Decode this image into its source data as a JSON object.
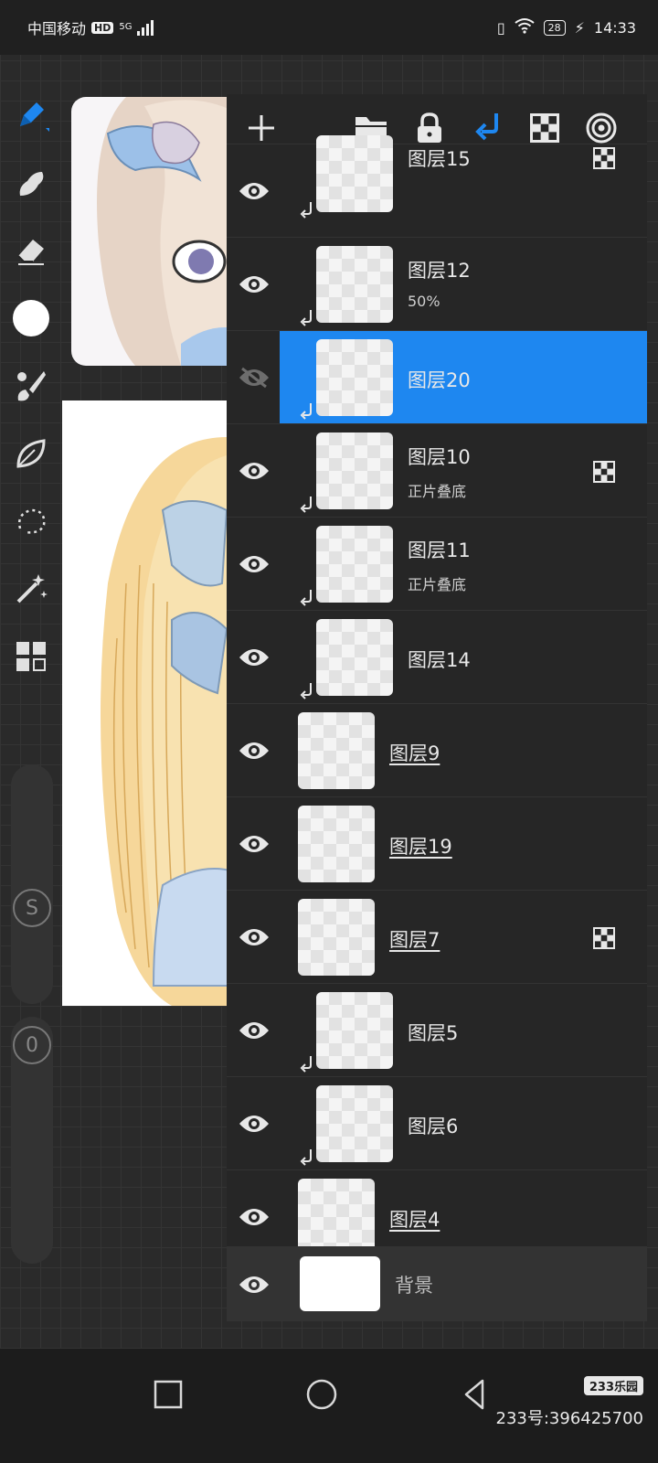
{
  "status_bar": {
    "carrier": "中国移动",
    "hd_badge": "HD",
    "network": "5G",
    "battery": "28",
    "time": "14:33"
  },
  "tool_sliders": {
    "size_label": "S",
    "opacity_label": "0"
  },
  "layers": [
    {
      "name": "图层15",
      "sub": "",
      "clipped": true,
      "alpha_lock": true,
      "selected": false,
      "hidden": false
    },
    {
      "name": "图层12",
      "sub": "50%",
      "clipped": true,
      "alpha_lock": false,
      "selected": false,
      "hidden": false
    },
    {
      "name": "图层20",
      "sub": "",
      "clipped": true,
      "alpha_lock": false,
      "selected": true,
      "hidden": true
    },
    {
      "name": "图层10",
      "sub": "正片叠底",
      "clipped": true,
      "alpha_lock": true,
      "selected": false,
      "hidden": false
    },
    {
      "name": "图层11",
      "sub": "正片叠底",
      "clipped": true,
      "alpha_lock": false,
      "selected": false,
      "hidden": false
    },
    {
      "name": "图层14",
      "sub": "",
      "clipped": true,
      "alpha_lock": false,
      "selected": false,
      "hidden": false
    },
    {
      "name": "图层9",
      "sub": "",
      "clipped": false,
      "alpha_lock": false,
      "selected": false,
      "hidden": false
    },
    {
      "name": "图层19",
      "sub": "",
      "clipped": false,
      "alpha_lock": false,
      "selected": false,
      "hidden": false
    },
    {
      "name": "图层7",
      "sub": "",
      "clipped": false,
      "alpha_lock": true,
      "selected": false,
      "hidden": false
    },
    {
      "name": "图层5",
      "sub": "",
      "clipped": true,
      "alpha_lock": false,
      "selected": false,
      "hidden": false
    },
    {
      "name": "图层6",
      "sub": "",
      "clipped": true,
      "alpha_lock": false,
      "selected": false,
      "hidden": false
    },
    {
      "name": "图层4",
      "sub": "",
      "clipped": false,
      "alpha_lock": false,
      "selected": false,
      "hidden": false
    }
  ],
  "background_layer": {
    "name": "背景"
  },
  "watermark": {
    "badge": "233乐园",
    "text": "233号:396425700"
  },
  "colors": {
    "accent": "#1e87f0",
    "panel": "#262626",
    "current_brush_color": "#ffffff"
  }
}
